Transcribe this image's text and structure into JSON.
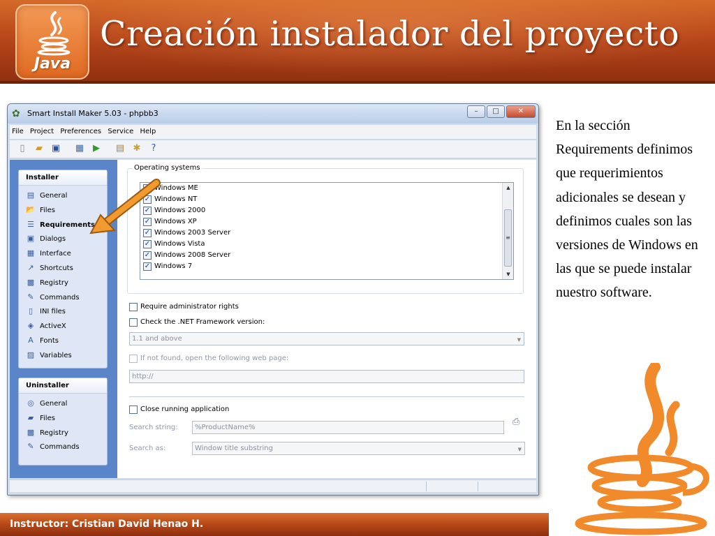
{
  "slide": {
    "title": "Creación instalador del proyecto",
    "logo_text": "Java",
    "description": "En la sección Requirements definimos que requerimientos adicionales se desean y definimos cuales son las versiones de Windows en las que se puede instalar nuestro software.",
    "footer": "Instructor: Cristian David Henao H."
  },
  "colors": {
    "header_orange": "#b8461a",
    "sidebar_blue": "#5a86c9",
    "annotation_arrow": "#f39a2e"
  },
  "window": {
    "title": "Smart Install Maker 5.03 - phpbb3",
    "controls": {
      "minimize": "–",
      "maximize": "□",
      "close": "✕"
    },
    "menu": [
      "File",
      "Project",
      "Preferences",
      "Service",
      "Help"
    ],
    "toolbar_icons": [
      "new-file-icon",
      "open-folder-icon",
      "save-icon",
      "build-icon",
      "run-icon",
      "package-icon",
      "settings-icon",
      "help-icon"
    ]
  },
  "sidebar": {
    "installer": {
      "header": "Installer",
      "items": [
        {
          "label": "General",
          "icon": "general-icon",
          "glyph": "▤"
        },
        {
          "label": "Files",
          "icon": "files-icon",
          "glyph": "📂"
        },
        {
          "label": "Requirements",
          "icon": "requirements-icon",
          "glyph": "☰",
          "active": true
        },
        {
          "label": "Dialogs",
          "icon": "dialogs-icon",
          "glyph": "▣"
        },
        {
          "label": "Interface",
          "icon": "interface-icon",
          "glyph": "▦"
        },
        {
          "label": "Shortcuts",
          "icon": "shortcuts-icon",
          "glyph": "↗"
        },
        {
          "label": "Registry",
          "icon": "registry-icon",
          "glyph": "▩"
        },
        {
          "label": "Commands",
          "icon": "commands-icon",
          "glyph": "✎"
        },
        {
          "label": "INI files",
          "icon": "ini-files-icon",
          "glyph": "▯"
        },
        {
          "label": "ActiveX",
          "icon": "activex-icon",
          "glyph": "◈"
        },
        {
          "label": "Fonts",
          "icon": "fonts-icon",
          "glyph": "A"
        },
        {
          "label": "Variables",
          "icon": "variables-icon",
          "glyph": "▨"
        }
      ]
    },
    "uninstaller": {
      "header": "Uninstaller",
      "items": [
        {
          "label": "General",
          "icon": "general-icon",
          "glyph": "◎"
        },
        {
          "label": "Files",
          "icon": "files-icon",
          "glyph": "▰"
        },
        {
          "label": "Registry",
          "icon": "registry-icon",
          "glyph": "▩"
        },
        {
          "label": "Commands",
          "icon": "commands-icon",
          "glyph": "✎"
        }
      ]
    }
  },
  "requirements": {
    "os_group_label": "Operating systems",
    "operating_systems": [
      {
        "label": "Windows ME",
        "checked": true
      },
      {
        "label": "Windows NT",
        "checked": true
      },
      {
        "label": "Windows 2000",
        "checked": true
      },
      {
        "label": "Windows XP",
        "checked": true
      },
      {
        "label": "Windows 2003 Server",
        "checked": true
      },
      {
        "label": "Windows Vista",
        "checked": true
      },
      {
        "label": "Windows 2008 Server",
        "checked": true
      },
      {
        "label": "Windows 7",
        "checked": true
      }
    ],
    "require_admin_label": "Require administrator rights",
    "require_admin_checked": false,
    "check_net_label": "Check the .NET Framework version:",
    "check_net_checked": false,
    "net_version_value": "1.1 and above",
    "if_not_found_label": "If not found, open the following web page:",
    "web_page_value": "http://",
    "close_app_label": "Close running application",
    "close_app_checked": false,
    "search_string_label": "Search string:",
    "search_string_value": "%ProductName%",
    "search_as_label": "Search as:",
    "search_as_value": "Window title substring"
  }
}
